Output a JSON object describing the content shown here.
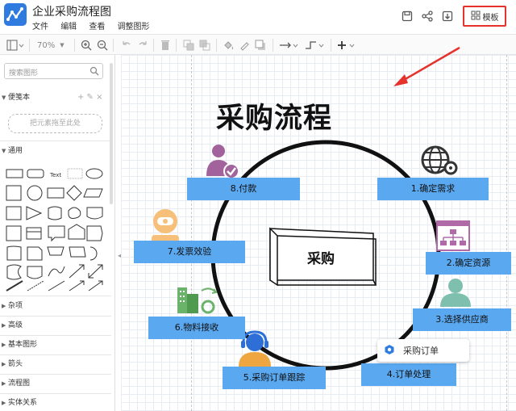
{
  "app": {
    "title": "企业采购流程图"
  },
  "menu": [
    "文件",
    "编辑",
    "查看",
    "调整图形"
  ],
  "header": {
    "template_label": "模板",
    "icons": [
      "save-icon",
      "share-icon",
      "download-icon",
      "template-icon"
    ]
  },
  "toolbar": {
    "zoom": "70%"
  },
  "sidebar": {
    "search_placeholder": "搜索图形",
    "scratchpad": {
      "title": "便笺本",
      "hint": "把元素拖至此处"
    },
    "general": {
      "title": "通用",
      "text_shape": "Text"
    },
    "categories": [
      "杂项",
      "高级",
      "基本图形",
      "箭头",
      "流程图",
      "实体关系"
    ]
  },
  "diagram": {
    "title": "采购流程",
    "center": "采购",
    "steps": [
      "1.确定需求",
      "2.确定资源",
      "3.选择供应商",
      "4.订单处理",
      "5.采购订单跟踪",
      "6.物料接收",
      "7.发票效验",
      "8.付款"
    ],
    "tooltip": "采购订单"
  },
  "colors": {
    "accent": "#2f7be0",
    "label_fill": "#5aa8f0",
    "highlight_border": "#e5322d"
  }
}
